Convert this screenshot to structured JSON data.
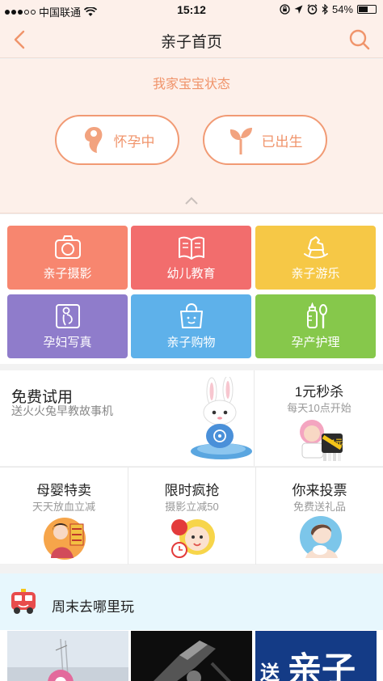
{
  "status_bar": {
    "carrier": "中国联通",
    "time": "15:12",
    "battery": "54%",
    "battery_level": 0.54
  },
  "nav": {
    "title": "亲子首页",
    "back_icon": "chevron-left-icon",
    "search_icon": "search-icon"
  },
  "baby_status": {
    "heading": "我家宝宝状态",
    "options": [
      {
        "label": "怀孕中",
        "icon": "fetus-icon"
      },
      {
        "label": "已出生",
        "icon": "sprout-icon"
      }
    ]
  },
  "categories": [
    {
      "label": "亲子摄影",
      "color": "#f7866f",
      "icon": "camera-icon"
    },
    {
      "label": "幼儿教育",
      "color": "#f26d6d",
      "icon": "book-icon"
    },
    {
      "label": "亲子游乐",
      "color": "#f6c846",
      "icon": "rocking-horse-icon"
    },
    {
      "label": "孕妇写真",
      "color": "#8f7ccb",
      "icon": "maternity-photo-icon"
    },
    {
      "label": "亲子购物",
      "color": "#5eb1ea",
      "icon": "shopping-bag-icon"
    },
    {
      "label": "孕产护理",
      "color": "#86c84b",
      "icon": "bottle-spoon-icon"
    }
  ],
  "promos": {
    "free_trial": {
      "title": "免费试用",
      "subtitle": "送火火兔早教故事机"
    },
    "flash_sale": {
      "title": "1元秒杀",
      "subtitle": "每天10点开始"
    },
    "row2": [
      {
        "title": "母婴特卖",
        "subtitle": "天天放血立减"
      },
      {
        "title": "限时疯抢",
        "subtitle": "摄影立减50"
      },
      {
        "title": "你来投票",
        "subtitle": "免费送礼品"
      }
    ]
  },
  "weekend": {
    "title": "周末去哪里玩",
    "icon": "bus-icon",
    "banner_text": "送",
    "banner_text2": "亲子"
  },
  "colors": {
    "accent": "#f0946b",
    "header_bg": "#fdf0ea"
  }
}
